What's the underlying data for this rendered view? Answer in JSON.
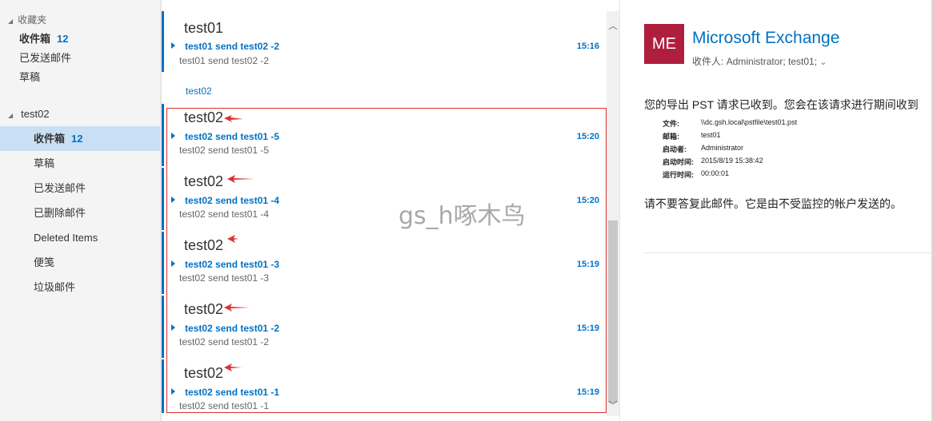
{
  "sidebar": {
    "favorites_header": "收藏夹",
    "favorites": [
      {
        "label": "收件箱",
        "count": "12"
      },
      {
        "label": "已发送邮件"
      },
      {
        "label": "草稿"
      }
    ],
    "account": "test02",
    "folders": [
      {
        "label": "收件箱",
        "count": "12",
        "selected": true
      },
      {
        "label": "草稿"
      },
      {
        "label": "已发送邮件"
      },
      {
        "label": "已删除邮件"
      },
      {
        "label": "Deleted Items"
      },
      {
        "label": "便笺"
      },
      {
        "label": "垃圾邮件"
      }
    ]
  },
  "message_list": {
    "group_label": "test02",
    "watermark": "gs_h啄木鸟",
    "conversations": [
      {
        "sender": "test01",
        "subject": "test01 send test02 -2",
        "preview": "test01 send test02 -2",
        "time": "15:16"
      },
      {
        "sender": "test02",
        "subject": "test02 send test01 -5",
        "preview": "test02 send test01 -5",
        "time": "15:20"
      },
      {
        "sender": "test02",
        "subject": "test02 send test01 -4",
        "preview": "test02 send test01 -4",
        "time": "15:20"
      },
      {
        "sender": "test02",
        "subject": "test02 send test01 -3",
        "preview": "test02 send test01 -3",
        "time": "15:19"
      },
      {
        "sender": "test02",
        "subject": "test02 send test01 -2",
        "preview": "test02 send test01 -2",
        "time": "15:19"
      },
      {
        "sender": "test02",
        "subject": "test02 send test01 -1",
        "preview": "test02 send test01 -1",
        "time": "15:19"
      }
    ]
  },
  "reading_pane": {
    "avatar_initials": "ME",
    "sender": "Microsoft Exchange",
    "recipients_label": "收件人:",
    "recipients": "Administrator; test01;",
    "body_line1": "您的导出 PST 请求已收到。您会在该请求进行期间收到",
    "details": [
      {
        "key": "文件:",
        "value": "\\\\dc.gsh.local\\pstfile\\test01.pst"
      },
      {
        "key": "邮箱:",
        "value": "test01"
      },
      {
        "key": "启动者:",
        "value": "Administrator"
      },
      {
        "key": "启动时间:",
        "value": "2015/8/19 15:38:42"
      },
      {
        "key": "运行时间:",
        "value": "00:00:01"
      }
    ],
    "body_line2": "请不要答复此邮件。它是由不受监控的帐户发送的。"
  },
  "colors": {
    "accent": "#0072c6",
    "selected_folder": "#c9dff3",
    "avatar": "#b01e3e",
    "annotation_red": "#e03030"
  }
}
